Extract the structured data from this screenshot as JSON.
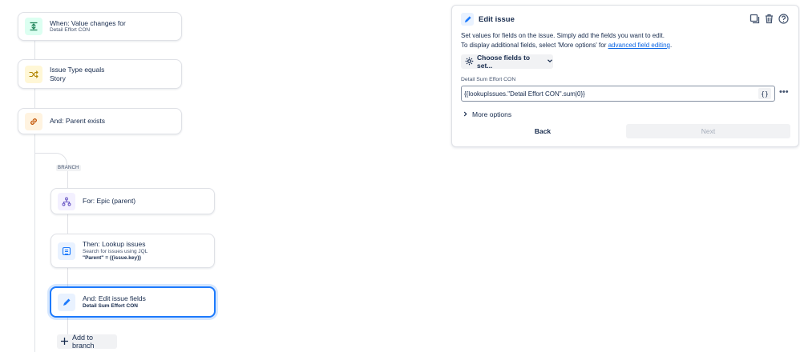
{
  "flow": {
    "trigger": {
      "title": "When: Value changes for",
      "subtitle": "Detail Effort CON"
    },
    "condition_type": {
      "title": "Issue Type equals",
      "subtitle": "Story"
    },
    "condition_parent": {
      "title": "And: Parent exists"
    },
    "branch_label": "BRANCH",
    "branch_for": {
      "title": "For: Epic (parent)"
    },
    "lookup": {
      "title": "Then: Lookup issues",
      "subtitle": "Search for issues using JQL",
      "jql": "\"Parent\" = {{issue.key}}"
    },
    "edit": {
      "title": "And: Edit issue fields",
      "subtitle": "Detail Sum Effort CON"
    },
    "add_branch_label": "Add to branch"
  },
  "panel": {
    "title": "Edit issue",
    "desc_line1": "Set values for fields on the issue. Simply add the fields you want to edit.",
    "desc_line2_prefix": "To display additional fields, select 'More options' for ",
    "desc_link": "advanced field editing",
    "desc_line2_suffix": ".",
    "choose_fields_label": "Choose fields to set...",
    "field_label": "Detail Sum Effort CON",
    "field_value": "{{lookupIssues.\"Detail Effort CON\".sum|0}}",
    "braces_label": "{}",
    "more_options_label": "More options",
    "back_label": "Back",
    "next_label": "Next"
  },
  "icons": {
    "trigger": "value-change-icon",
    "condition_type": "shuffle-icon",
    "condition_parent": "link-icon",
    "branch_for": "hierarchy-icon",
    "lookup": "lookup-icon",
    "edit": "pencil-icon"
  },
  "colors": {
    "accent": "#1d7afc",
    "link": "#0c66e4"
  }
}
